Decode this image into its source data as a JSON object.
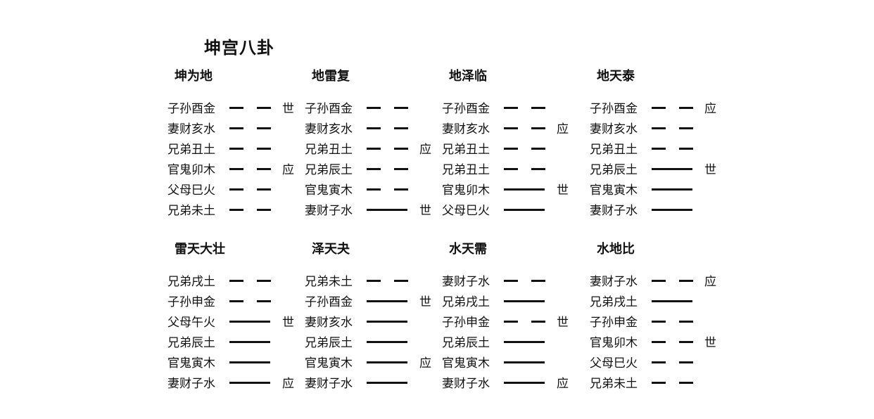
{
  "title": "坤宫八卦",
  "guas": [
    {
      "name": "坤为地",
      "yao": [
        {
          "label": "子孙酉金",
          "yin": true,
          "mark": "世"
        },
        {
          "label": "妻财亥水",
          "yin": true,
          "mark": ""
        },
        {
          "label": "兄弟丑土",
          "yin": true,
          "mark": ""
        },
        {
          "label": "官鬼卯木",
          "yin": true,
          "mark": "应"
        },
        {
          "label": "父母巳火",
          "yin": true,
          "mark": ""
        },
        {
          "label": "兄弟未土",
          "yin": true,
          "mark": ""
        }
      ]
    },
    {
      "name": "地雷复",
      "yao": [
        {
          "label": "子孙酉金",
          "yin": true,
          "mark": ""
        },
        {
          "label": "妻财亥水",
          "yin": true,
          "mark": ""
        },
        {
          "label": "兄弟丑土",
          "yin": true,
          "mark": "应"
        },
        {
          "label": "兄弟辰土",
          "yin": true,
          "mark": ""
        },
        {
          "label": "官鬼寅木",
          "yin": true,
          "mark": ""
        },
        {
          "label": "妻财子水",
          "yin": false,
          "mark": "世"
        }
      ]
    },
    {
      "name": "地泽临",
      "yao": [
        {
          "label": "子孙酉金",
          "yin": true,
          "mark": ""
        },
        {
          "label": "妻财亥水",
          "yin": true,
          "mark": "应"
        },
        {
          "label": "兄弟丑土",
          "yin": true,
          "mark": ""
        },
        {
          "label": "兄弟丑土",
          "yin": true,
          "mark": ""
        },
        {
          "label": "官鬼卯木",
          "yin": false,
          "mark": "世"
        },
        {
          "label": "父母巳火",
          "yin": false,
          "mark": ""
        }
      ]
    },
    {
      "name": "地天泰",
      "yao": [
        {
          "label": "子孙酉金",
          "yin": true,
          "mark": "应"
        },
        {
          "label": "妻财亥水",
          "yin": true,
          "mark": ""
        },
        {
          "label": "兄弟丑土",
          "yin": true,
          "mark": ""
        },
        {
          "label": "兄弟辰土",
          "yin": false,
          "mark": "世"
        },
        {
          "label": "官鬼寅木",
          "yin": false,
          "mark": ""
        },
        {
          "label": "妻财子水",
          "yin": false,
          "mark": ""
        }
      ]
    },
    {
      "name": "雷天大壮",
      "yao": [
        {
          "label": "兄弟戌土",
          "yin": true,
          "mark": ""
        },
        {
          "label": "子孙申金",
          "yin": true,
          "mark": ""
        },
        {
          "label": "父母午火",
          "yin": false,
          "mark": "世"
        },
        {
          "label": "兄弟辰土",
          "yin": false,
          "mark": ""
        },
        {
          "label": "官鬼寅木",
          "yin": false,
          "mark": ""
        },
        {
          "label": "妻财子水",
          "yin": false,
          "mark": "应"
        }
      ]
    },
    {
      "name": "泽天夬",
      "yao": [
        {
          "label": "兄弟未土",
          "yin": true,
          "mark": ""
        },
        {
          "label": "子孙酉金",
          "yin": false,
          "mark": "世"
        },
        {
          "label": "妻财亥水",
          "yin": false,
          "mark": ""
        },
        {
          "label": "兄弟辰土",
          "yin": false,
          "mark": ""
        },
        {
          "label": "官鬼寅木",
          "yin": false,
          "mark": "应"
        },
        {
          "label": "妻财子水",
          "yin": false,
          "mark": ""
        }
      ]
    },
    {
      "name": "水天需",
      "yao": [
        {
          "label": "妻财子水",
          "yin": true,
          "mark": ""
        },
        {
          "label": "兄弟戌土",
          "yin": false,
          "mark": ""
        },
        {
          "label": "子孙申金",
          "yin": true,
          "mark": "世"
        },
        {
          "label": "兄弟辰土",
          "yin": false,
          "mark": ""
        },
        {
          "label": "官鬼寅木",
          "yin": false,
          "mark": ""
        },
        {
          "label": "妻财子水",
          "yin": false,
          "mark": "应"
        }
      ]
    },
    {
      "name": "水地比",
      "yao": [
        {
          "label": "妻财子水",
          "yin": true,
          "mark": "应"
        },
        {
          "label": "兄弟戌土",
          "yin": false,
          "mark": ""
        },
        {
          "label": "子孙申金",
          "yin": true,
          "mark": ""
        },
        {
          "label": "官鬼卯木",
          "yin": true,
          "mark": "世"
        },
        {
          "label": "父母巳火",
          "yin": true,
          "mark": ""
        },
        {
          "label": "兄弟未土",
          "yin": true,
          "mark": ""
        }
      ]
    }
  ]
}
